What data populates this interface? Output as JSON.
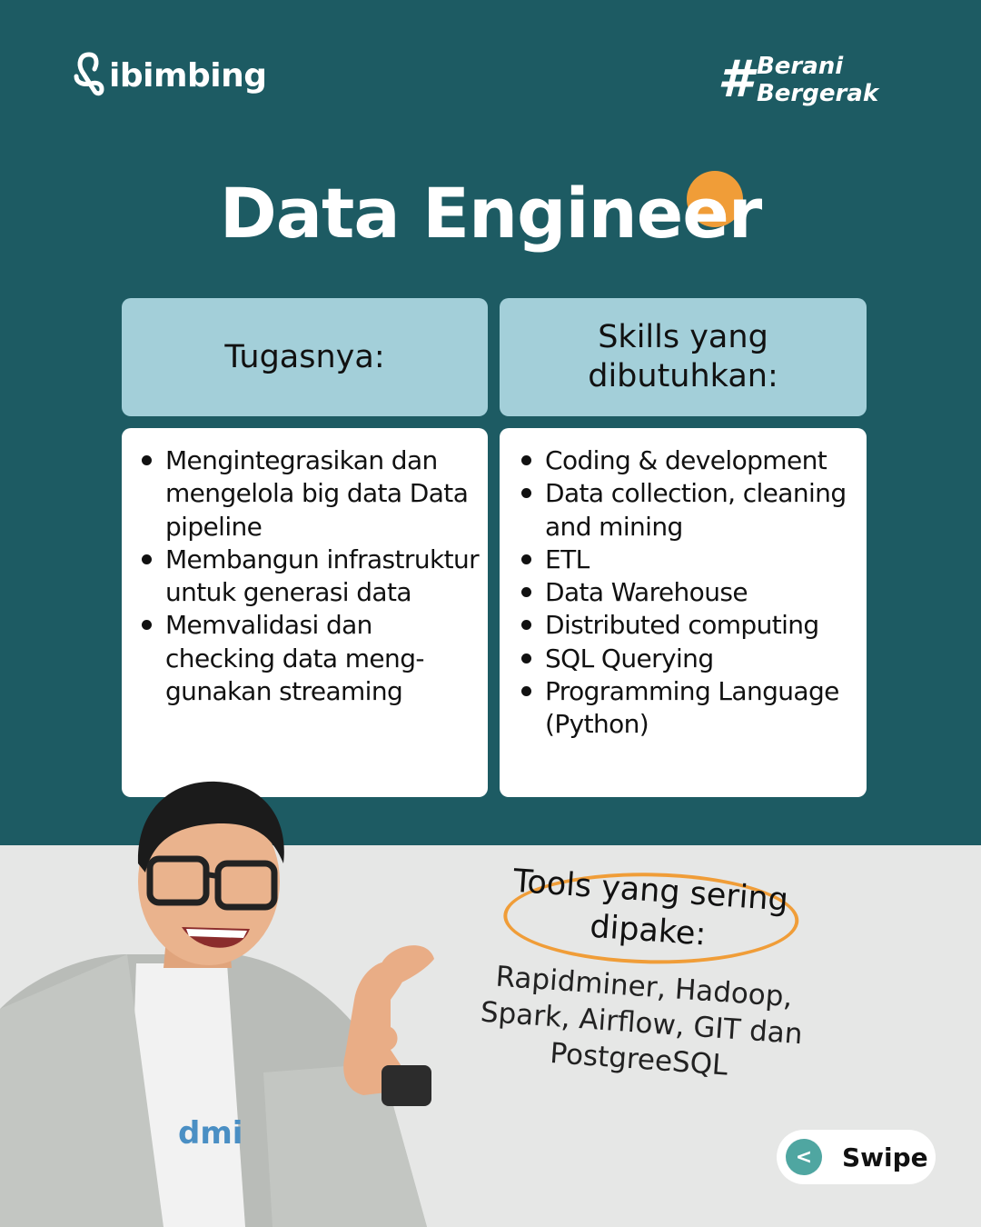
{
  "brand": {
    "logo_text": "ibimbing",
    "hashtag_line1": "Berani",
    "hashtag_line2": "Bergerak"
  },
  "title": "Data Engineer",
  "left_column": {
    "heading": "Tugasnya:",
    "items": [
      "Mengintegrasikan dan mengelola big data Data pipeline",
      "Membangun infrastruktur untuk generasi data",
      "Memvalidasi dan checking data meng-gunakan streaming"
    ]
  },
  "right_column": {
    "heading_line1": "Skills yang",
    "heading_line2": "dibutuhkan:",
    "items": [
      "Coding & development",
      "Data collection, cleaning and mining",
      "ETL",
      "Data Warehouse",
      "Distributed computing",
      "SQL Querying",
      "Programming Language (Python)"
    ]
  },
  "tools": {
    "title_line1": "Tools yang sering",
    "title_line2": "dipake:",
    "list_line1": "Rapidminer, Hadoop,",
    "list_line2": "Spark, Airflow, GIT dan",
    "list_line3": "PostgreeSQL"
  },
  "shirt_text": "dmi",
  "swipe": {
    "icon": "<",
    "label": "Swipe"
  },
  "colors": {
    "teal": "#1d5b63",
    "light_blue": "#a3cfd9",
    "orange": "#f09d38",
    "swipe_teal": "#4fa6a1",
    "gray": "#e6e7e6"
  }
}
